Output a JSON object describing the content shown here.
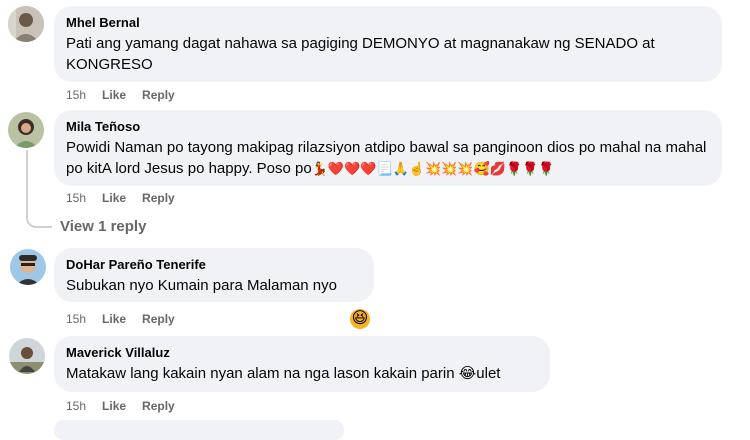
{
  "comments": [
    {
      "author": "Mhel Bernal",
      "text": "Pati ang yamang dagat nahawa sa pagiging DEMONYO at magnanakaw ng SENADO at KONGRESO",
      "time": "15h",
      "like": "Like",
      "reply": "Reply"
    },
    {
      "author": "Mila Teñoso",
      "text": "Powidi Naman po tayong makipag rilazsiyon atdipo bawal sa panginoon dios po mahal na mahal po kitA lord Jesus po happy. Poso po",
      "emojis": "💃❤️❤️❤️📃🙏☝️💥💥💥🥰💋🌹🌹🌹",
      "time": "15h",
      "like": "Like",
      "reply": "Reply",
      "view_replies": "View 1 reply"
    },
    {
      "author": "DoHar Pareño Tenerife",
      "text": "Subukan nyo Kumain para Malaman nyo",
      "time": "15h",
      "like": "Like",
      "reply": "Reply",
      "reaction": "😆"
    },
    {
      "author": "Maverick Villaluz",
      "text_before": "Matakaw lang kakain nyan alam na nga lason kakain parin ",
      "emoji": "😂",
      "text_after": "ulet",
      "time": "15h",
      "like": "Like",
      "reply": "Reply"
    }
  ]
}
